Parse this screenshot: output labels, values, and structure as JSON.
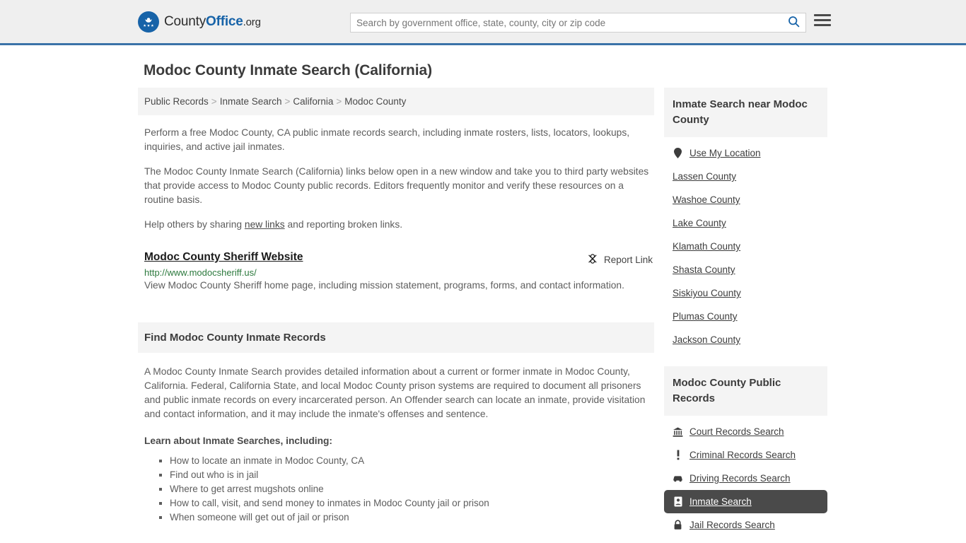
{
  "header": {
    "brand": {
      "county": "County",
      "office": "Office",
      "org": ".org",
      "icon": "eagle-seal-icon"
    },
    "search": {
      "placeholder": "Search by government office, state, county, city or zip code",
      "value": "",
      "search_icon": "search-icon"
    },
    "menu_icon": "hamburger-menu-icon"
  },
  "page": {
    "title": "Modoc County Inmate Search (California)"
  },
  "breadcrumb": {
    "separator": ">",
    "items": [
      {
        "label": "Public Records"
      },
      {
        "label": "Inmate Search"
      },
      {
        "label": "California"
      },
      {
        "label": "Modoc County"
      }
    ]
  },
  "intro": {
    "p1": "Perform a free Modoc County, CA public inmate records search, including inmate rosters, lists, locators, lookups, inquiries, and active jail inmates.",
    "p2": "The Modoc County Inmate Search (California) links below open in a new window and take you to third party websites that provide access to Modoc County public records. Editors frequently monitor and verify these resources on a routine basis.",
    "p3_before": "Help others by sharing ",
    "p3_link": "new links",
    "p3_after": " and reporting broken links."
  },
  "result": {
    "title": "Modoc County Sheriff Website",
    "url": "http://www.modocsheriff.us/",
    "description": "View Modoc County Sheriff home page, including mission statement, programs, forms, and contact information.",
    "report": {
      "label": "Report Link",
      "icon": "broken-link-icon"
    }
  },
  "section": {
    "heading": "Find Modoc County Inmate Records",
    "paragraph": "A Modoc County Inmate Search provides detailed information about a current or former inmate in Modoc County, California. Federal, California State, and local Modoc County prison systems are required to document all prisoners and public inmate records on every incarcerated person. An Offender search can locate an inmate, provide visitation and contact information, and it may include the inmate's offenses and sentence.",
    "learn_heading": "Learn about Inmate Searches, including:",
    "learn_items": [
      "How to locate an inmate in Modoc County, CA",
      "Find out who is in jail",
      "Where to get arrest mugshots online",
      "How to call, visit, and send money to inmates in Modoc County jail or prison",
      "When someone will get out of jail or prison"
    ]
  },
  "sidebar": {
    "nearby": {
      "heading": "Inmate Search near Modoc County",
      "items": [
        {
          "label": "Use My Location",
          "icon": "map-pin-icon",
          "active": false
        },
        {
          "label": "Lassen County",
          "icon": "",
          "active": false
        },
        {
          "label": "Washoe County",
          "icon": "",
          "active": false
        },
        {
          "label": "Lake County",
          "icon": "",
          "active": false
        },
        {
          "label": "Klamath County",
          "icon": "",
          "active": false
        },
        {
          "label": "Shasta County",
          "icon": "",
          "active": false
        },
        {
          "label": "Siskiyou County",
          "icon": "",
          "active": false
        },
        {
          "label": "Plumas County",
          "icon": "",
          "active": false
        },
        {
          "label": "Jackson County",
          "icon": "",
          "active": false
        }
      ]
    },
    "public_records": {
      "heading": "Modoc County Public Records",
      "items": [
        {
          "label": "Court Records Search",
          "icon": "courthouse-icon",
          "active": false
        },
        {
          "label": "Criminal Records Search",
          "icon": "exclamation-icon",
          "active": false
        },
        {
          "label": "Driving Records Search",
          "icon": "car-icon",
          "active": false
        },
        {
          "label": "Inmate Search",
          "icon": "id-badge-icon",
          "active": true
        },
        {
          "label": "Jail Records Search",
          "icon": "lock-icon",
          "active": false
        }
      ]
    }
  },
  "colors": {
    "brand_blue": "#1763a8",
    "header_rule": "#3a72a8",
    "url_green": "#2d7a3e",
    "active_row": "#4a4a4a",
    "panel_gray": "#f4f4f4"
  }
}
